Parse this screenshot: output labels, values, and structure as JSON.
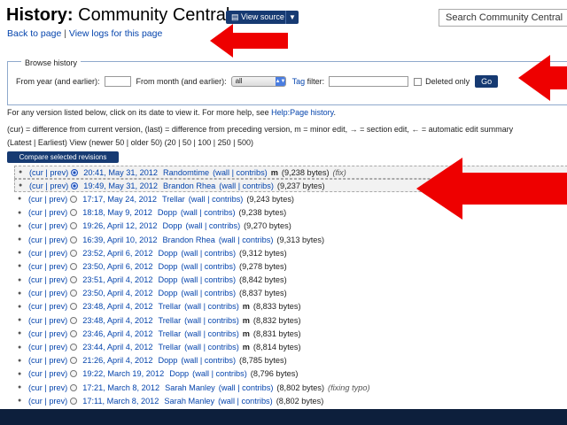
{
  "header": {
    "title_prefix": "History:",
    "title_page": "Community Central",
    "view_source_label": "View source",
    "search_placeholder": "Search Community Central",
    "back_link": "Back to page",
    "separator": "|",
    "logs_link": "View logs for this page"
  },
  "browse": {
    "legend": "Browse history",
    "year_label": "From year (and earlier):",
    "month_label": "From month (and earlier):",
    "month_value": "all",
    "tag_link": "Tag",
    "tag_label_rest": "filter:",
    "deleted_label": "Deleted only",
    "go_label": "Go"
  },
  "info": {
    "line1_pre": "For any version listed below, click on its date to view it. For more help, see ",
    "line1_link": "Help:Page history",
    "line1_post": ".",
    "line2": "(cur) = difference from current version, (last) = difference from preceding version, m = minor edit, → = section edit, ← = automatic edit summary",
    "line3": "(Latest | Earliest) View (newer 50 | older 50) (20 | 50 | 100 | 250 | 500)",
    "compare_label": "Compare selected revisions"
  },
  "revisions": [
    {
      "cp": "(cur | prev)",
      "date": "20:41, May 31, 2012",
      "user": "Randomtime",
      "wc": "(wall | contribs)",
      "minor": "m",
      "bytes": "(9,238 bytes)",
      "summary": "(fix)"
    },
    {
      "cp": "(cur | prev)",
      "date": "19:49, May 31, 2012",
      "user": "Brandon Rhea",
      "wc": "(wall | contribs)",
      "minor": "",
      "bytes": "(9,237 bytes)",
      "summary": ""
    },
    {
      "cp": "(cur | prev)",
      "date": "17:17, May 24, 2012",
      "user": "Trellar",
      "wc": "(wall | contribs)",
      "minor": "",
      "bytes": "(9,243 bytes)",
      "summary": ""
    },
    {
      "cp": "(cur | prev)",
      "date": "18:18, May 9, 2012",
      "user": "Dopp",
      "wc": "(wall | contribs)",
      "minor": "",
      "bytes": "(9,238 bytes)",
      "summary": ""
    },
    {
      "cp": "(cur | prev)",
      "date": "19:26, April 12, 2012",
      "user": "Dopp",
      "wc": "(wall | contribs)",
      "minor": "",
      "bytes": "(9,270 bytes)",
      "summary": ""
    },
    {
      "cp": "(cur | prev)",
      "date": "16:39, April 10, 2012",
      "user": "Brandon Rhea",
      "wc": "(wall | contribs)",
      "minor": "",
      "bytes": "(9,313 bytes)",
      "summary": ""
    },
    {
      "cp": "(cur | prev)",
      "date": "23:52, April 6, 2012",
      "user": "Dopp",
      "wc": "(wall | contribs)",
      "minor": "",
      "bytes": "(9,312 bytes)",
      "summary": ""
    },
    {
      "cp": "(cur | prev)",
      "date": "23:50, April 6, 2012",
      "user": "Dopp",
      "wc": "(wall | contribs)",
      "minor": "",
      "bytes": "(9,278 bytes)",
      "summary": ""
    },
    {
      "cp": "(cur | prev)",
      "date": "23:51, April 4, 2012",
      "user": "Dopp",
      "wc": "(wall | contribs)",
      "minor": "",
      "bytes": "(8,842 bytes)",
      "summary": ""
    },
    {
      "cp": "(cur | prev)",
      "date": "23:50, April 4, 2012",
      "user": "Dopp",
      "wc": "(wall | contribs)",
      "minor": "",
      "bytes": "(8,837 bytes)",
      "summary": ""
    },
    {
      "cp": "(cur | prev)",
      "date": "23:48, April 4, 2012",
      "user": "Trellar",
      "wc": "(wall | contribs)",
      "minor": "m",
      "bytes": "(8,833 bytes)",
      "summary": ""
    },
    {
      "cp": "(cur | prev)",
      "date": "23:48, April 4, 2012",
      "user": "Trellar",
      "wc": "(wall | contribs)",
      "minor": "m",
      "bytes": "(8,832 bytes)",
      "summary": ""
    },
    {
      "cp": "(cur | prev)",
      "date": "23:46, April 4, 2012",
      "user": "Trellar",
      "wc": "(wall | contribs)",
      "minor": "m",
      "bytes": "(8,831 bytes)",
      "summary": ""
    },
    {
      "cp": "(cur | prev)",
      "date": "23:44, April 4, 2012",
      "user": "Trellar",
      "wc": "(wall | contribs)",
      "minor": "m",
      "bytes": "(8,814 bytes)",
      "summary": ""
    },
    {
      "cp": "(cur | prev)",
      "date": "21:26, April 4, 2012",
      "user": "Dopp",
      "wc": "(wall | contribs)",
      "minor": "",
      "bytes": "(8,785 bytes)",
      "summary": ""
    },
    {
      "cp": "(cur | prev)",
      "date": "19:22, March 19, 2012",
      "user": "Dopp",
      "wc": "(wall | contribs)",
      "minor": "",
      "bytes": "(8,796 bytes)",
      "summary": ""
    },
    {
      "cp": "(cur | prev)",
      "date": "17:21, March 8, 2012",
      "user": "Sarah Manley",
      "wc": "(wall | contribs)",
      "minor": "",
      "bytes": "(8,802 bytes)",
      "summary": "(fixing typo)"
    },
    {
      "cp": "(cur | prev)",
      "date": "17:11, March 8, 2012",
      "user": "Sarah Manley",
      "wc": "(wall | contribs)",
      "minor": "",
      "bytes": "(8,802 bytes)",
      "summary": ""
    }
  ],
  "colors": {
    "accent": "#163a72",
    "link": "#0645ad",
    "arrow": "#ee0000",
    "frame": "#0d1f3c"
  }
}
